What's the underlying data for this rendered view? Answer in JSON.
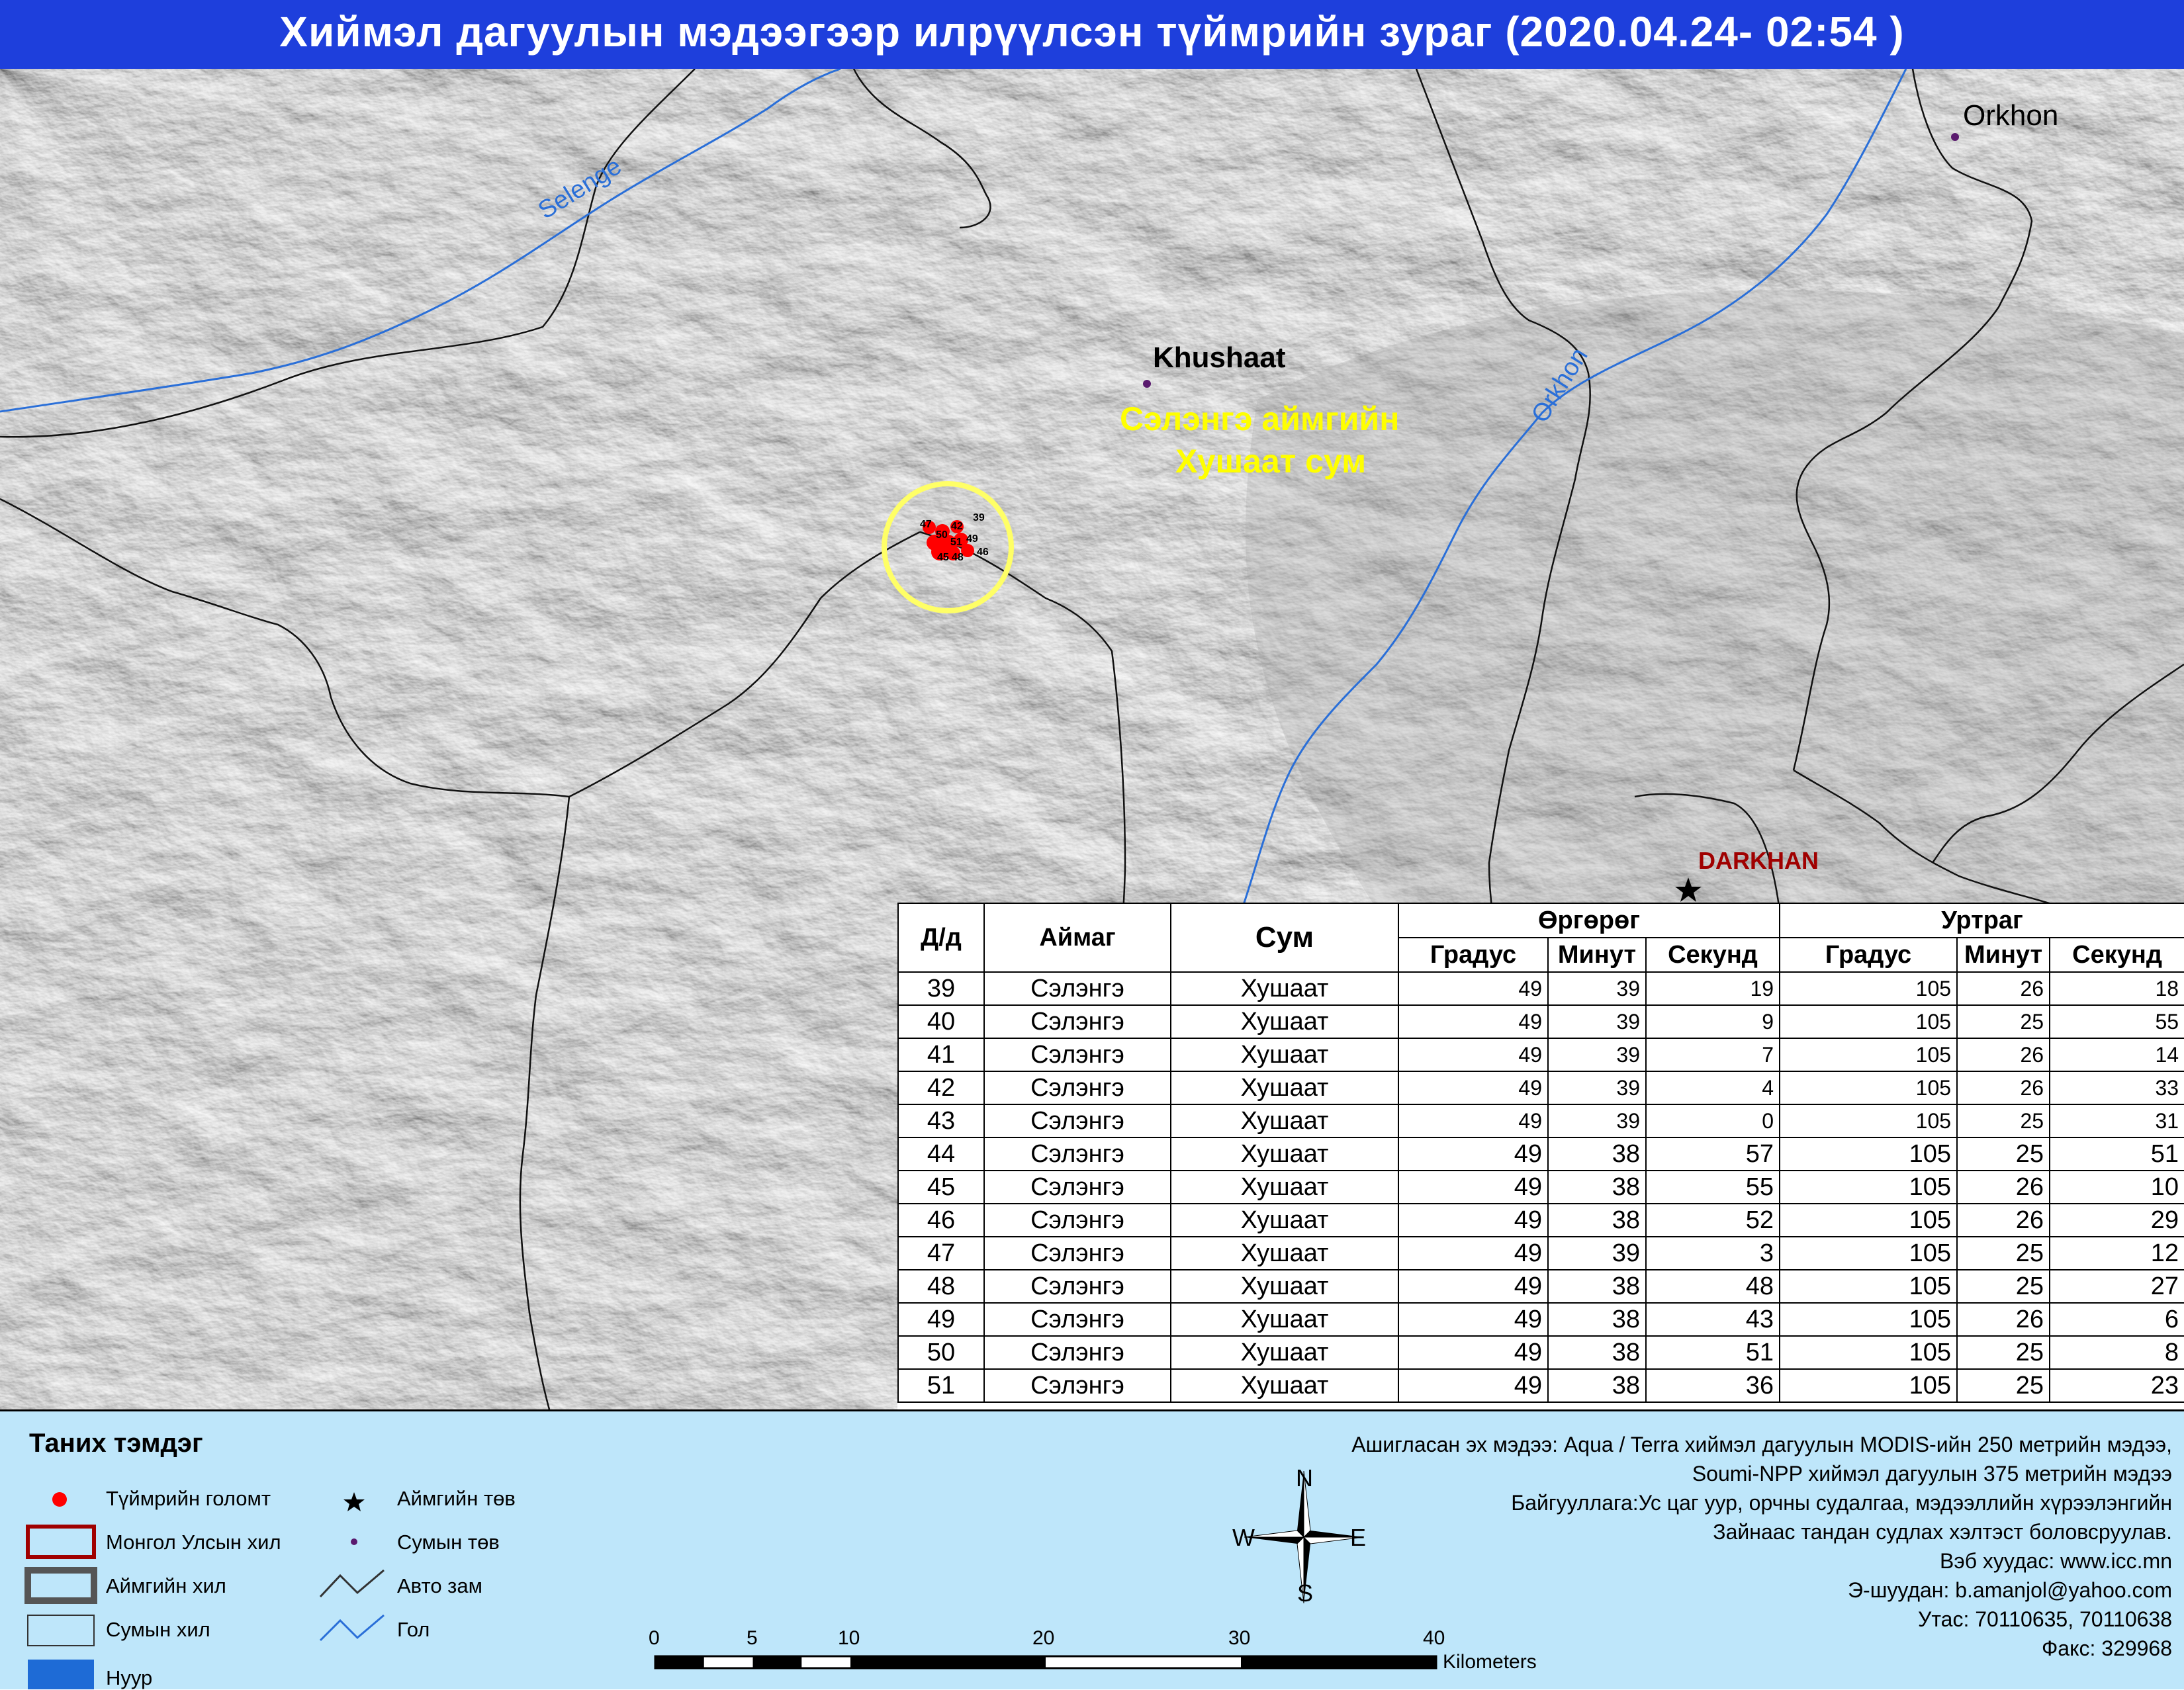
{
  "title": "Хиймэл дагуулын мэдээгээр илрүүлсэн түймрийн зураг  (2020.04.24- 02:54 )",
  "map": {
    "places": {
      "orkhon": "Orkhon",
      "khushaat": "Khushaat",
      "darkhan": "DARKHAN"
    },
    "rivers": {
      "selenge": "Selenge",
      "orkhon": "Orkhon"
    },
    "area_label": {
      "line1": "Сэлэнгэ аймгийн",
      "line2": "Хушаат сум"
    },
    "fire_labels": [
      "47",
      "42",
      "39",
      "50",
      "51",
      "49",
      "45",
      "48",
      "46"
    ],
    "colors": {
      "fire": "#ff0000",
      "circle": "#ffff66",
      "area_label": "#ffff00",
      "river": "#2a6fd8",
      "darkhan": "#a00000",
      "soum_center": "#5a1a6e"
    }
  },
  "table": {
    "headers": {
      "no": "Д/д",
      "aimag": "Аймаг",
      "sum": "Сум",
      "lat": "Өргөрөг",
      "lon": "Уртраг",
      "deg": "Градус",
      "min": "Минут",
      "sec": "Секунд"
    },
    "rows": [
      {
        "no": "39",
        "aimag": "Сэлэнгэ",
        "sum": "Хушаат",
        "lat_deg": "49",
        "lat_min": "39",
        "lat_sec": "19",
        "lon_deg": "105",
        "lon_min": "26",
        "lon_sec": "18"
      },
      {
        "no": "40",
        "aimag": "Сэлэнгэ",
        "sum": "Хушаат",
        "lat_deg": "49",
        "lat_min": "39",
        "lat_sec": "9",
        "lon_deg": "105",
        "lon_min": "25",
        "lon_sec": "55"
      },
      {
        "no": "41",
        "aimag": "Сэлэнгэ",
        "sum": "Хушаат",
        "lat_deg": "49",
        "lat_min": "39",
        "lat_sec": "7",
        "lon_deg": "105",
        "lon_min": "26",
        "lon_sec": "14"
      },
      {
        "no": "42",
        "aimag": "Сэлэнгэ",
        "sum": "Хушаат",
        "lat_deg": "49",
        "lat_min": "39",
        "lat_sec": "4",
        "lon_deg": "105",
        "lon_min": "26",
        "lon_sec": "33"
      },
      {
        "no": "43",
        "aimag": "Сэлэнгэ",
        "sum": "Хушаат",
        "lat_deg": "49",
        "lat_min": "39",
        "lat_sec": "0",
        "lon_deg": "105",
        "lon_min": "25",
        "lon_sec": "31"
      },
      {
        "no": "44",
        "aimag": "Сэлэнгэ",
        "sum": "Хушаат",
        "lat_deg": "49",
        "lat_min": "38",
        "lat_sec": "57",
        "lon_deg": "105",
        "lon_min": "25",
        "lon_sec": "51"
      },
      {
        "no": "45",
        "aimag": "Сэлэнгэ",
        "sum": "Хушаат",
        "lat_deg": "49",
        "lat_min": "38",
        "lat_sec": "55",
        "lon_deg": "105",
        "lon_min": "26",
        "lon_sec": "10"
      },
      {
        "no": "46",
        "aimag": "Сэлэнгэ",
        "sum": "Хушаат",
        "lat_deg": "49",
        "lat_min": "38",
        "lat_sec": "52",
        "lon_deg": "105",
        "lon_min": "26",
        "lon_sec": "29"
      },
      {
        "no": "47",
        "aimag": "Сэлэнгэ",
        "sum": "Хушаат",
        "lat_deg": "49",
        "lat_min": "39",
        "lat_sec": "3",
        "lon_deg": "105",
        "lon_min": "25",
        "lon_sec": "12"
      },
      {
        "no": "48",
        "aimag": "Сэлэнгэ",
        "sum": "Хушаат",
        "lat_deg": "49",
        "lat_min": "38",
        "lat_sec": "48",
        "lon_deg": "105",
        "lon_min": "25",
        "lon_sec": "27"
      },
      {
        "no": "49",
        "aimag": "Сэлэнгэ",
        "sum": "Хушаат",
        "lat_deg": "49",
        "lat_min": "38",
        "lat_sec": "43",
        "lon_deg": "105",
        "lon_min": "26",
        "lon_sec": "6"
      },
      {
        "no": "50",
        "aimag": "Сэлэнгэ",
        "sum": "Хушаат",
        "lat_deg": "49",
        "lat_min": "38",
        "lat_sec": "51",
        "lon_deg": "105",
        "lon_min": "25",
        "lon_sec": "8"
      },
      {
        "no": "51",
        "aimag": "Сэлэнгэ",
        "sum": "Хушаат",
        "lat_deg": "49",
        "lat_min": "38",
        "lat_sec": "36",
        "lon_deg": "105",
        "lon_min": "25",
        "lon_sec": "23"
      }
    ]
  },
  "legend": {
    "title": "Таних тэмдэг",
    "items": {
      "fire_point": "Түймрийн голомт",
      "aimag_center": "Аймгийн төв",
      "mongolia_border": "Монгол Улсын хил",
      "soum_center": "Сумын төв",
      "aimag_border": "Аймгийн хил",
      "road": "Авто зам",
      "soum_border": "Сумын хил",
      "river": "Гол",
      "lake": "Нуур"
    }
  },
  "compass": {
    "n": "N",
    "s": "S",
    "e": "E",
    "w": "W"
  },
  "scale": {
    "ticks": [
      "0",
      "5",
      "10",
      "20",
      "30",
      "40"
    ],
    "unit": "Kilometers"
  },
  "info": [
    "Ашигласан эх мэдээ: Aqua / Terra хиймэл дагуулын MODIS-ийн 250 метрийн мэдээ,",
    "Soumi-NPP хиймэл дагуулын 375 метрийн мэдээ",
    "Байгууллага:Ус цаг уур, орчны судалгаа, мэдээллийн хүрээлэнгийн",
    "Зайнаас тандан судлах хэлтэст боловсруулав.",
    "Вэб хуудас: www.icc.mn",
    "Э-шуудан: b.amanjol@yahoo.com",
    "Утас: 70110635, 70110638",
    "Факс: 329968"
  ]
}
